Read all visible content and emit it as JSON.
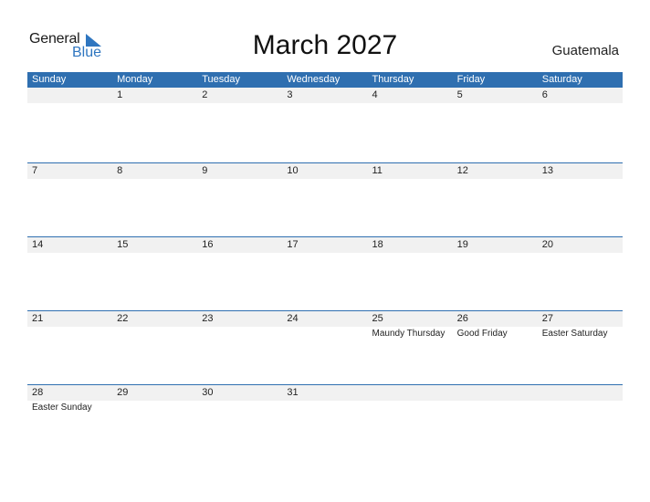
{
  "logo": {
    "text_general": "General",
    "text_blue": "Blue"
  },
  "title": "March 2027",
  "country": "Guatemala",
  "colors": {
    "accent": "#2f6fb0",
    "band": "#f1f1f1"
  },
  "weekdays": [
    "Sunday",
    "Monday",
    "Tuesday",
    "Wednesday",
    "Thursday",
    "Friday",
    "Saturday"
  ],
  "weeks": [
    {
      "days": [
        "",
        "1",
        "2",
        "3",
        "4",
        "5",
        "6"
      ],
      "holidays": [
        "",
        "",
        "",
        "",
        "",
        "",
        ""
      ]
    },
    {
      "days": [
        "7",
        "8",
        "9",
        "10",
        "11",
        "12",
        "13"
      ],
      "holidays": [
        "",
        "",
        "",
        "",
        "",
        "",
        ""
      ]
    },
    {
      "days": [
        "14",
        "15",
        "16",
        "17",
        "18",
        "19",
        "20"
      ],
      "holidays": [
        "",
        "",
        "",
        "",
        "",
        "",
        ""
      ]
    },
    {
      "days": [
        "21",
        "22",
        "23",
        "24",
        "25",
        "26",
        "27"
      ],
      "holidays": [
        "",
        "",
        "",
        "",
        "Maundy Thursday",
        "Good Friday",
        "Easter Saturday"
      ]
    },
    {
      "days": [
        "28",
        "29",
        "30",
        "31",
        "",
        "",
        ""
      ],
      "holidays": [
        "Easter Sunday",
        "",
        "",
        "",
        "",
        "",
        ""
      ]
    }
  ]
}
